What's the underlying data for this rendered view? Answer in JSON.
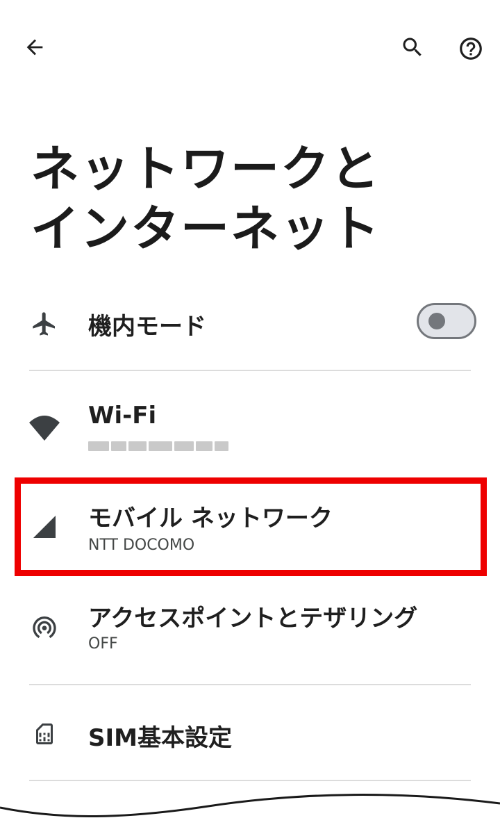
{
  "header": {
    "back_icon": "arrow-left-icon",
    "search_icon": "search-icon",
    "help_icon": "help-circle-icon"
  },
  "page": {
    "title_line1": "ネットワークと",
    "title_line2": "インターネット"
  },
  "items": [
    {
      "icon": "airplane-icon",
      "label": "機内モード",
      "toggle_state": "off"
    },
    {
      "icon": "wifi-icon",
      "label": "Wi-Fi",
      "sublabel_blurred": true
    },
    {
      "icon": "cellular-signal-icon",
      "label": "モバイル ネットワーク",
      "sublabel": "NTT DOCOMO"
    },
    {
      "icon": "hotspot-icon",
      "label": "アクセスポイントとテザリング",
      "sublabel": "OFF"
    },
    {
      "icon": "sim-card-icon",
      "label": "SIM基本設定"
    }
  ],
  "colors": {
    "highlight": "#ee0000",
    "text": "#1f1f1f",
    "subtext": "#444746",
    "divider": "#dcdcdc",
    "toggle_track": "#e2e4e9",
    "toggle_border": "#74777c"
  }
}
